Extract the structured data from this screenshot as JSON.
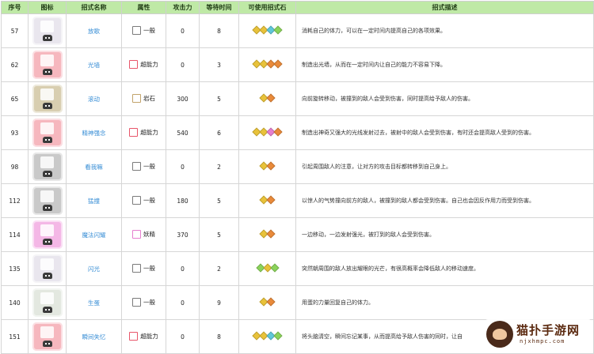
{
  "headers": [
    "序号",
    "图标",
    "招式名称",
    "属性",
    "攻击力",
    "等待时间",
    "可使用招式石",
    "招式描述"
  ],
  "rows": [
    {
      "no": "57",
      "tile": "#e9e6ee",
      "name": "放歌",
      "type": "一般",
      "type_color": "#7b7b7b",
      "atk": "0",
      "wait": "8",
      "gems": [
        "#e8c23a",
        "#e8c23a",
        "#5fc7d9",
        "#8bd35b"
      ],
      "desc": "消耗自己的体力，可以在一定时间内提高自己的各项效果。"
    },
    {
      "no": "62",
      "tile": "#f6b7be",
      "name": "光墙",
      "type": "超能力",
      "type_color": "#e8566a",
      "atk": "0",
      "wait": "3",
      "gems": [
        "#e8c23a",
        "#e8c23a",
        "#e98a3a",
        "#e98a3a"
      ],
      "desc": "制造出光墙，从而在一定时间内让自己的能力不容易下降。"
    },
    {
      "no": "65",
      "tile": "#d8ceb0",
      "name": "滚动",
      "type": "岩石",
      "type_color": "#c2a36b",
      "atk": "300",
      "wait": "5",
      "gems": [
        "#e8c23a",
        "#e98a3a"
      ],
      "desc": "向前旋转移动，被撞到的敌人会受到伤害，同时提高给予敌人的伤害。"
    },
    {
      "no": "93",
      "tile": "#f6b7be",
      "name": "精神强念",
      "type": "超能力",
      "type_color": "#e8566a",
      "atk": "540",
      "wait": "6",
      "gems": [
        "#e8c23a",
        "#e8c23a",
        "#e67fcf",
        "#e98a3a"
      ],
      "desc": "制造出神奇又强大的光线发射过去，被射中的敌人会受到伤害，有时还会提高敌人受到的伤害。"
    },
    {
      "no": "98",
      "tile": "#c9c9c9",
      "name": "看我嘛",
      "type": "一般",
      "type_color": "#7b7b7b",
      "atk": "0",
      "wait": "2",
      "gems": [
        "#e8c23a",
        "#e98a3a"
      ],
      "desc": "引起周围敌人的注意，让对方的攻击目标都转移到自己身上。"
    },
    {
      "no": "112",
      "tile": "#c9c9c9",
      "name": "猛撞",
      "type": "一般",
      "type_color": "#7b7b7b",
      "atk": "180",
      "wait": "5",
      "gems": [
        "#e8c23a",
        "#e98a3a"
      ],
      "desc": "以惊人的气势撞向前方的敌人，被撞到的敌人都会受到伤害。自己也会因反作用力而受到伤害。"
    },
    {
      "no": "114",
      "tile": "#f4b7e6",
      "name": "魔法闪耀",
      "type": "妖精",
      "type_color": "#e67fcf",
      "atk": "370",
      "wait": "5",
      "gems": [
        "#e8c23a",
        "#e98a3a"
      ],
      "desc": "一边移动，一边发射强光，被打到的敌人会受到伤害。"
    },
    {
      "no": "135",
      "tile": "#e9e6ee",
      "name": "闪光",
      "type": "一般",
      "type_color": "#7b7b7b",
      "atk": "0",
      "wait": "2",
      "gems": [
        "#8bd35b",
        "#e8c23a",
        "#8bd35b"
      ],
      "desc": "突然朝周围的敌人放出耀眼的光芒，有很高概率会降低敌人的移动速度。"
    },
    {
      "no": "140",
      "tile": "#e3e8e0",
      "name": "生蛋",
      "type": "一般",
      "type_color": "#7b7b7b",
      "atk": "0",
      "wait": "9",
      "gems": [
        "#e8c23a",
        "#e98a3a"
      ],
      "desc": "用蛋的力量回复自己的体力。"
    },
    {
      "no": "151",
      "tile": "#f6b7be",
      "name": "瞬间失忆",
      "type": "超能力",
      "type_color": "#e8566a",
      "atk": "0",
      "wait": "8",
      "gems": [
        "#e8c23a",
        "#e8c23a",
        "#5fc7d9",
        "#8bd35b"
      ],
      "desc": "将头脑清空，瞬间忘记某事，从而提高给予敌人伤害的同时，让自"
    }
  ],
  "watermark": {
    "title": "猫扑手游网",
    "url": "njxhmpc.com"
  }
}
